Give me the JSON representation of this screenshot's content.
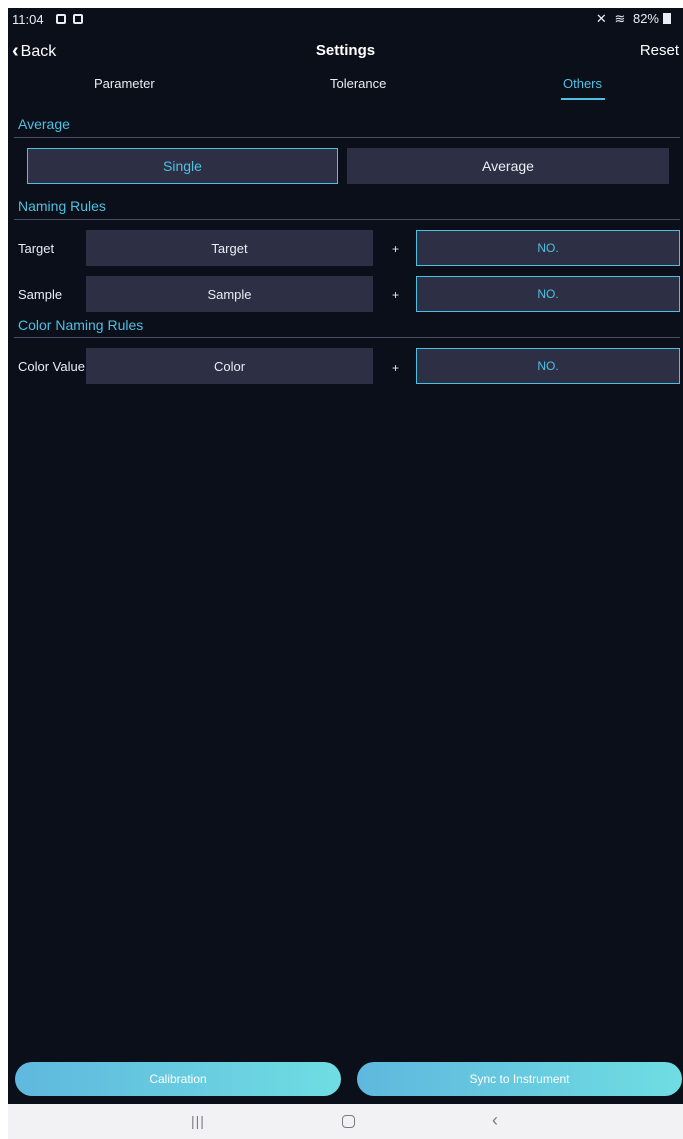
{
  "status_bar": {
    "time": "11:04",
    "battery": "82%"
  },
  "nav": {
    "back_label": "Back",
    "title": "Settings",
    "reset_label": "Reset"
  },
  "tabs": [
    {
      "label": "Parameter",
      "active": false
    },
    {
      "label": "Tolerance",
      "active": false
    },
    {
      "label": "Others",
      "active": true
    }
  ],
  "sections": {
    "average": {
      "title": "Average",
      "options": [
        {
          "label": "Single",
          "selected": true
        },
        {
          "label": "Average",
          "selected": false
        }
      ]
    },
    "naming_rules": {
      "title": "Naming Rules",
      "rows": [
        {
          "label": "Target",
          "prefix": "Target",
          "plus": "+",
          "suffix": "NO."
        },
        {
          "label": "Sample",
          "prefix": "Sample",
          "plus": "+",
          "suffix": "NO."
        }
      ]
    },
    "color_naming_rules": {
      "title": "Color Naming Rules",
      "rows": [
        {
          "label": "Color Value",
          "prefix": "Color",
          "plus": "+",
          "suffix": "NO."
        }
      ]
    }
  },
  "bottom_buttons": {
    "calibration": "Calibration",
    "sync": "Sync to Instrument"
  },
  "colors": {
    "accent": "#4fc0e0",
    "background": "#0b0f1a",
    "field": "#2d3045"
  }
}
